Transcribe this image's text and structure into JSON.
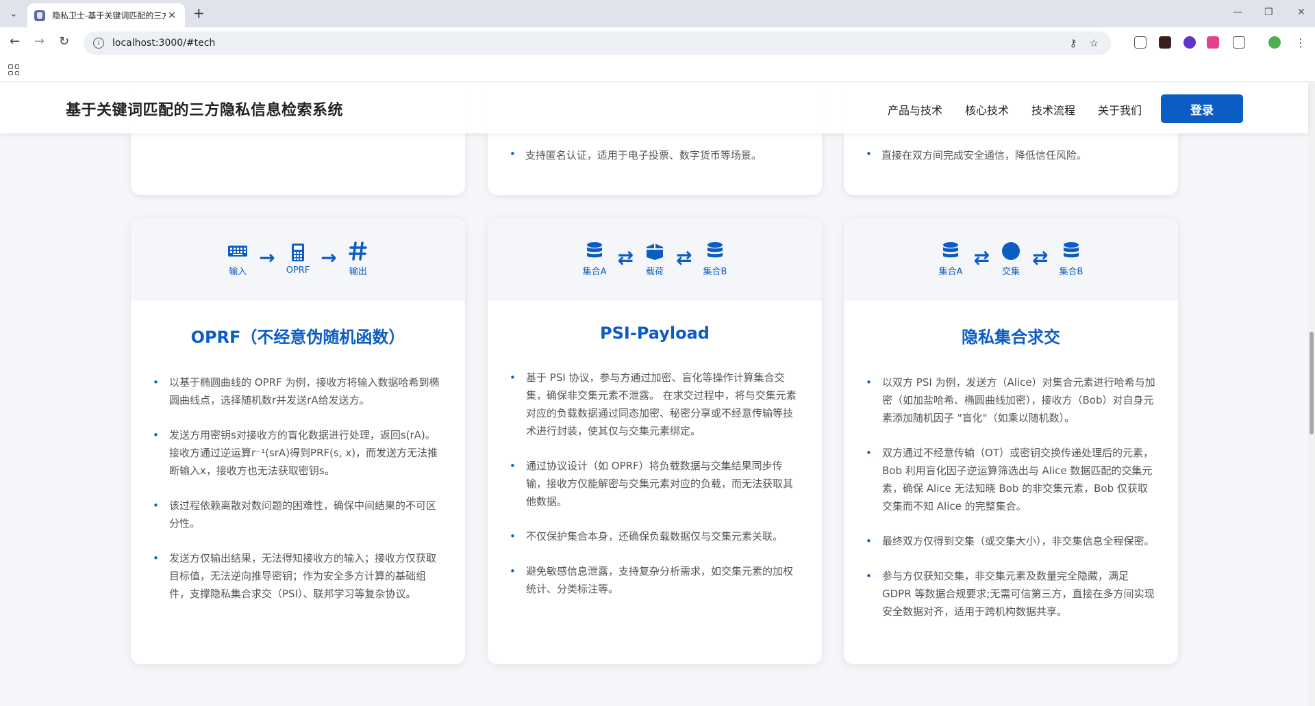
{
  "browser": {
    "tab_title": "隐私卫士-基于关键词匹配的三方",
    "url": "localhost:3000/#tech"
  },
  "header": {
    "title": "基于关键词匹配的三方隐私信息检索系统",
    "nav": [
      "产品与技术",
      "核心技术",
      "技术流程",
      "关于我们"
    ],
    "login": "登录"
  },
  "top_cards": [
    {
      "bullet": ""
    },
    {
      "bullet": "支持匿名认证，适用于电子投票、数字货币等场景。"
    },
    {
      "bullet": "直接在双方间完成安全通信，降低信任风险。"
    }
  ],
  "cards": [
    {
      "flow": [
        {
          "icon": "keyboard-icon",
          "label": "输入"
        },
        {
          "icon": "calculator-icon",
          "label": "OPRF"
        },
        {
          "icon": "hash-icon",
          "label": "输出"
        }
      ],
      "arrow": "→",
      "title": "OPRF（不经意伪随机函数）",
      "bullets": [
        "以基于椭圆曲线的 OPRF 为例，接收方将输入数据哈希到椭圆曲线点，选择随机数r并发送rA给发送方。",
        "发送方用密钥s对接收方的盲化数据进行处理，返回s(rA)。接收方通过逆运算r⁻¹(srA)得到PRF(s, x)，而发送方无法推断输入x，接收方也无法获取密钥s。",
        "该过程依赖离散对数问题的困难性，确保中间结果的不可区分性。",
        "发送方仅输出结果，无法得知接收方的输入；接收方仅获取目标值，无法逆向推导密钥；作为安全多方计算的基础组件，支撑隐私集合求交（PSI）、联邦学习等复杂协议。"
      ]
    },
    {
      "flow": [
        {
          "icon": "database-icon",
          "label": "集合A"
        },
        {
          "icon": "box-icon",
          "label": "载荷"
        },
        {
          "icon": "database-icon",
          "label": "集合B"
        }
      ],
      "arrow": "⇄",
      "title": "PSI-Payload",
      "bullets": [
        "基于 PSI 协议，参与方通过加密、盲化等操作计算集合交集，确保非交集元素不泄露。 在求交过程中，将与交集元素对应的负载数据通过同态加密、秘密分享或不经意传输等技术进行封装，使其仅与交集元素绑定。",
        "通过协议设计（如 OPRF）将负载数据与交集结果同步传输，接收方仅能解密与交集元素对应的负载，而无法获取其他数据。",
        "不仅保护集合本身，还确保负载数据仅与交集元素关联。",
        "避免敏感信息泄露，支持复杂分析需求，如交集元素的加权统计、分类标注等。"
      ]
    },
    {
      "flow": [
        {
          "icon": "database-icon",
          "label": "集合A"
        },
        {
          "icon": "circle-icon",
          "label": "交集"
        },
        {
          "icon": "database-icon",
          "label": "集合B"
        }
      ],
      "arrow": "⇄",
      "title": "隐私集合求交",
      "bullets": [
        "以双方 PSI 为例，发送方（Alice）对集合元素进行哈希与加密（如加盐哈希、椭圆曲线加密），接收方（Bob）对自身元素添加随机因子 \"盲化\"（如乘以随机数）。",
        "双方通过不经意传输（OT）或密钥交换传递处理后的元素，Bob 利用盲化因子逆运算筛选出与 Alice 数据匹配的交集元素，确保 Alice 无法知晓 Bob 的非交集元素，Bob 仅获取交集而不知 Alice 的完整集合。",
        "最终双方仅得到交集（或交集大小），非交集信息全程保密。",
        "参与方仅获知交集，非交集元素及数量完全隐藏，满足 GDPR 等数据合规要求;无需可信第三方，直接在多方间实现安全数据对齐，适用于跨机构数据共享。"
      ]
    }
  ],
  "colors": {
    "accent": "#0b5cc5",
    "page_bg": "#f4f6f9"
  }
}
